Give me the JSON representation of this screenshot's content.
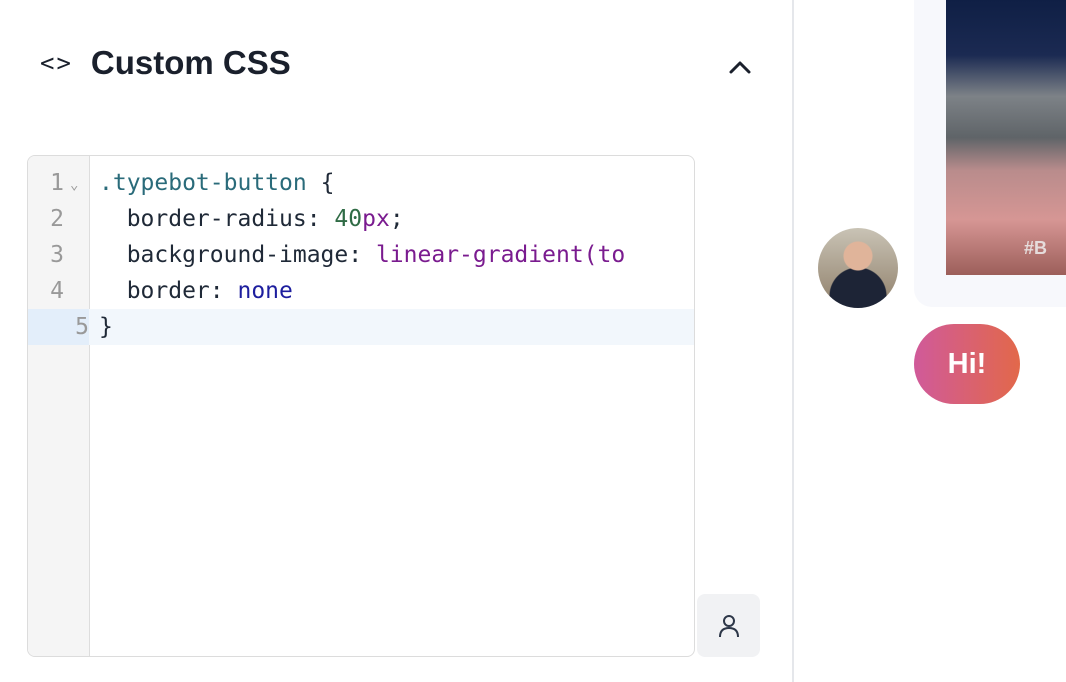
{
  "section": {
    "title": "Custom CSS",
    "icon": "code-icon",
    "collapse_icon": "chevron-up-icon"
  },
  "editor": {
    "lines": [
      {
        "n": "1",
        "parts": [
          {
            "t": ".typebot-button",
            "c": "sel"
          },
          {
            "t": " {",
            "c": ""
          }
        ]
      },
      {
        "n": "2",
        "parts": [
          {
            "t": "  border-radius: ",
            "c": ""
          },
          {
            "t": "40",
            "c": "num"
          },
          {
            "t": "px",
            "c": "unit"
          },
          {
            "t": ";",
            "c": ""
          }
        ]
      },
      {
        "n": "3",
        "parts": [
          {
            "t": "  background-image: ",
            "c": ""
          },
          {
            "t": "linear-gradient(to",
            "c": "fn"
          }
        ]
      },
      {
        "n": "4",
        "parts": [
          {
            "t": "  border: ",
            "c": ""
          },
          {
            "t": "none",
            "c": "kw"
          }
        ]
      },
      {
        "n": "5",
        "parts": [
          {
            "t": "}",
            "c": ""
          }
        ]
      }
    ],
    "active_line": 5
  },
  "preview": {
    "button_label": "Hi!",
    "image_tag": "#B",
    "button_gradient": [
      "#d05a9a",
      "#e2684a"
    ]
  }
}
